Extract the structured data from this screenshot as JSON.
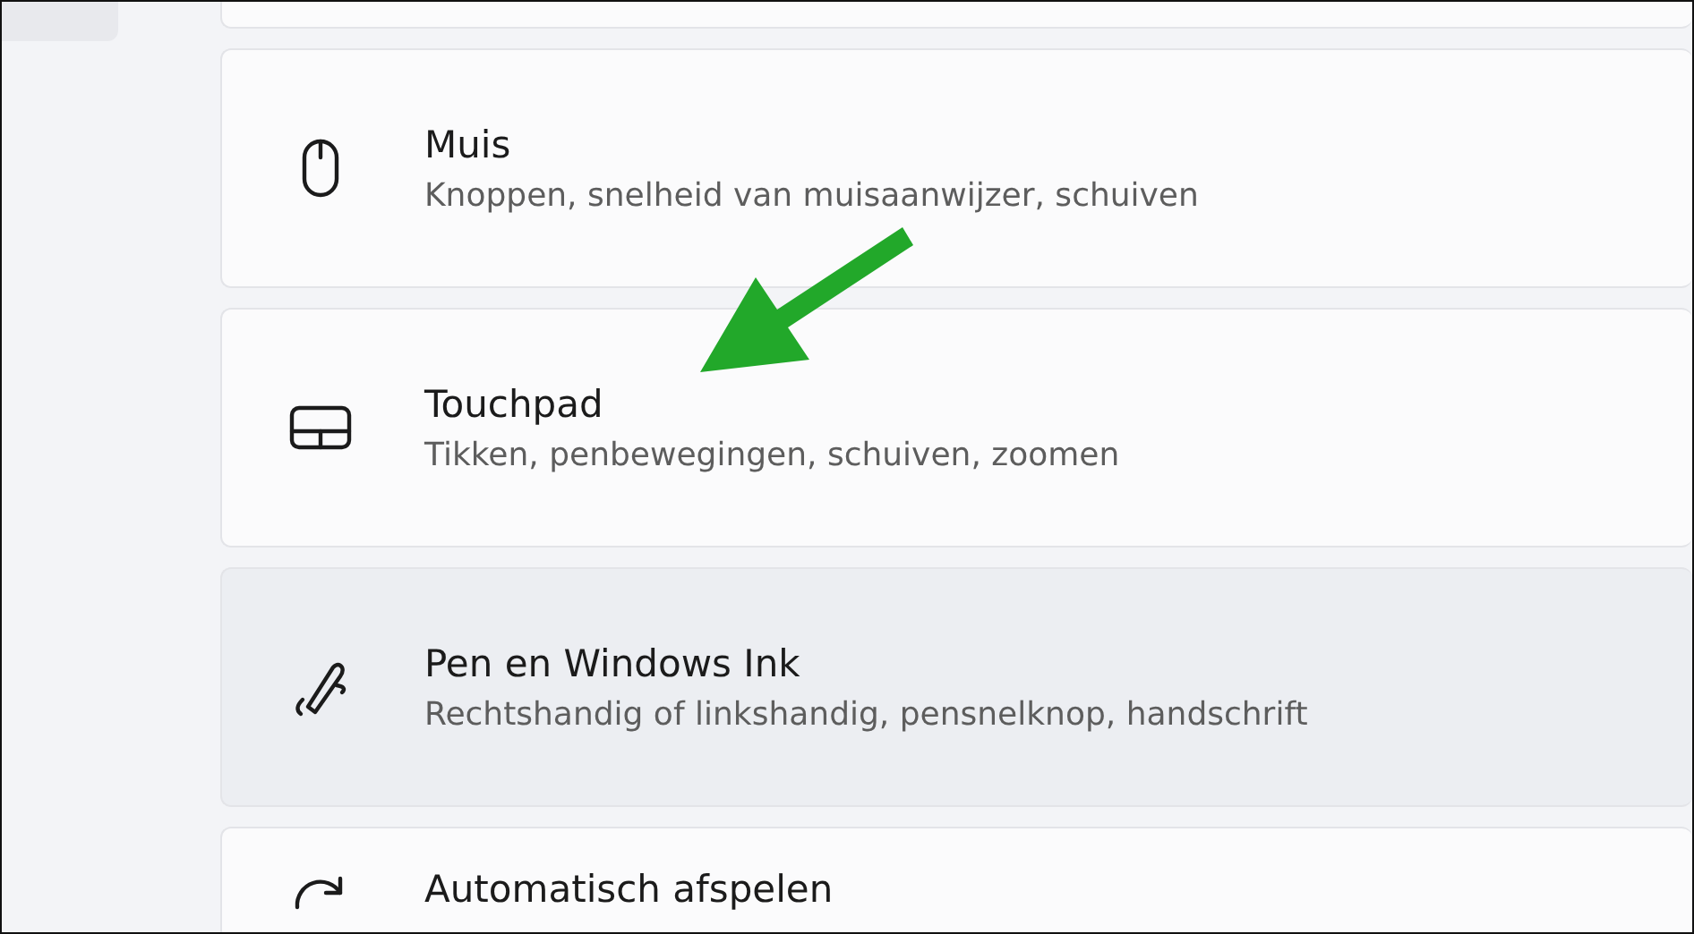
{
  "settings_items": [
    {
      "kind": "cut"
    },
    {
      "kind": "mouse",
      "title": "Muis",
      "subtitle": "Knoppen, snelheid van muisaanwijzer, schuiven",
      "highlighted": false
    },
    {
      "kind": "touchpad",
      "title": "Touchpad",
      "subtitle": "Tikken, penbewegingen, schuiven, zoomen",
      "highlighted": false
    },
    {
      "kind": "pen",
      "title": "Pen en Windows Ink",
      "subtitle": "Rechtshandig of linkshandig, pensnelknop, handschrift",
      "highlighted": true
    },
    {
      "kind": "autoplay",
      "title": "Automatisch afspelen",
      "highlighted": false
    }
  ],
  "annotation": {
    "kind": "arrow",
    "color": "#22a82a"
  }
}
